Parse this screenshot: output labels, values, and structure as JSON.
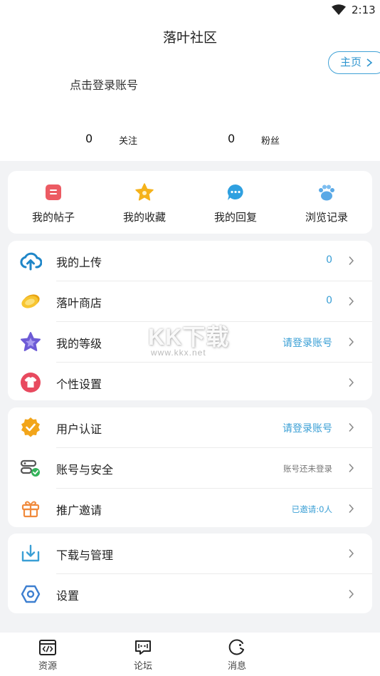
{
  "status_bar": {
    "time": "2:13",
    "wifi_icon": "wifi-icon"
  },
  "header": {
    "title": "落叶社区",
    "home_button": "主页",
    "login_prompt": "点击登录账号",
    "stats": [
      {
        "count": "0",
        "label": "关注"
      },
      {
        "count": "0",
        "label": "粉丝"
      }
    ]
  },
  "quick_actions": [
    {
      "label": "我的帖子",
      "icon": "post-icon",
      "color": "#ec5b63"
    },
    {
      "label": "我的收藏",
      "icon": "star-icon",
      "color": "#f5b21a"
    },
    {
      "label": "我的回复",
      "icon": "comment-icon",
      "color": "#2fa0e0"
    },
    {
      "label": "浏览记录",
      "icon": "paw-icon",
      "color": "#5aa9e6"
    }
  ],
  "menu_group_1": [
    {
      "label": "我的上传",
      "value": "0",
      "icon": "cloud-upload-icon"
    },
    {
      "label": "落叶商店",
      "value": "0",
      "icon": "coin-icon"
    },
    {
      "label": "我的等级",
      "value": "请登录账号",
      "icon": "level-star-icon"
    },
    {
      "label": "个性设置",
      "value": "",
      "icon": "tshirt-icon"
    }
  ],
  "menu_group_2": [
    {
      "label": "用户认证",
      "value": "请登录账号",
      "icon": "verified-badge-icon"
    },
    {
      "label": "账号与安全",
      "value": "账号还未登录",
      "icon": "account-security-icon"
    },
    {
      "label": "推广邀请",
      "value": "已邀请:0人",
      "icon": "gift-icon"
    }
  ],
  "menu_group_3": [
    {
      "label": "下载与管理",
      "icon": "download-icon"
    },
    {
      "label": "设置",
      "icon": "settings-hex-icon"
    }
  ],
  "watermark": {
    "brand": "KK下载",
    "url": "www.kkx.net"
  },
  "tab_bar": [
    {
      "label": "资源",
      "icon": "code-window-icon"
    },
    {
      "label": "论坛",
      "icon": "forum-chat-icon"
    },
    {
      "label": "消息",
      "icon": "message-icon"
    }
  ],
  "colors": {
    "accent": "#3a9fd5",
    "background": "#f2f3f5"
  }
}
